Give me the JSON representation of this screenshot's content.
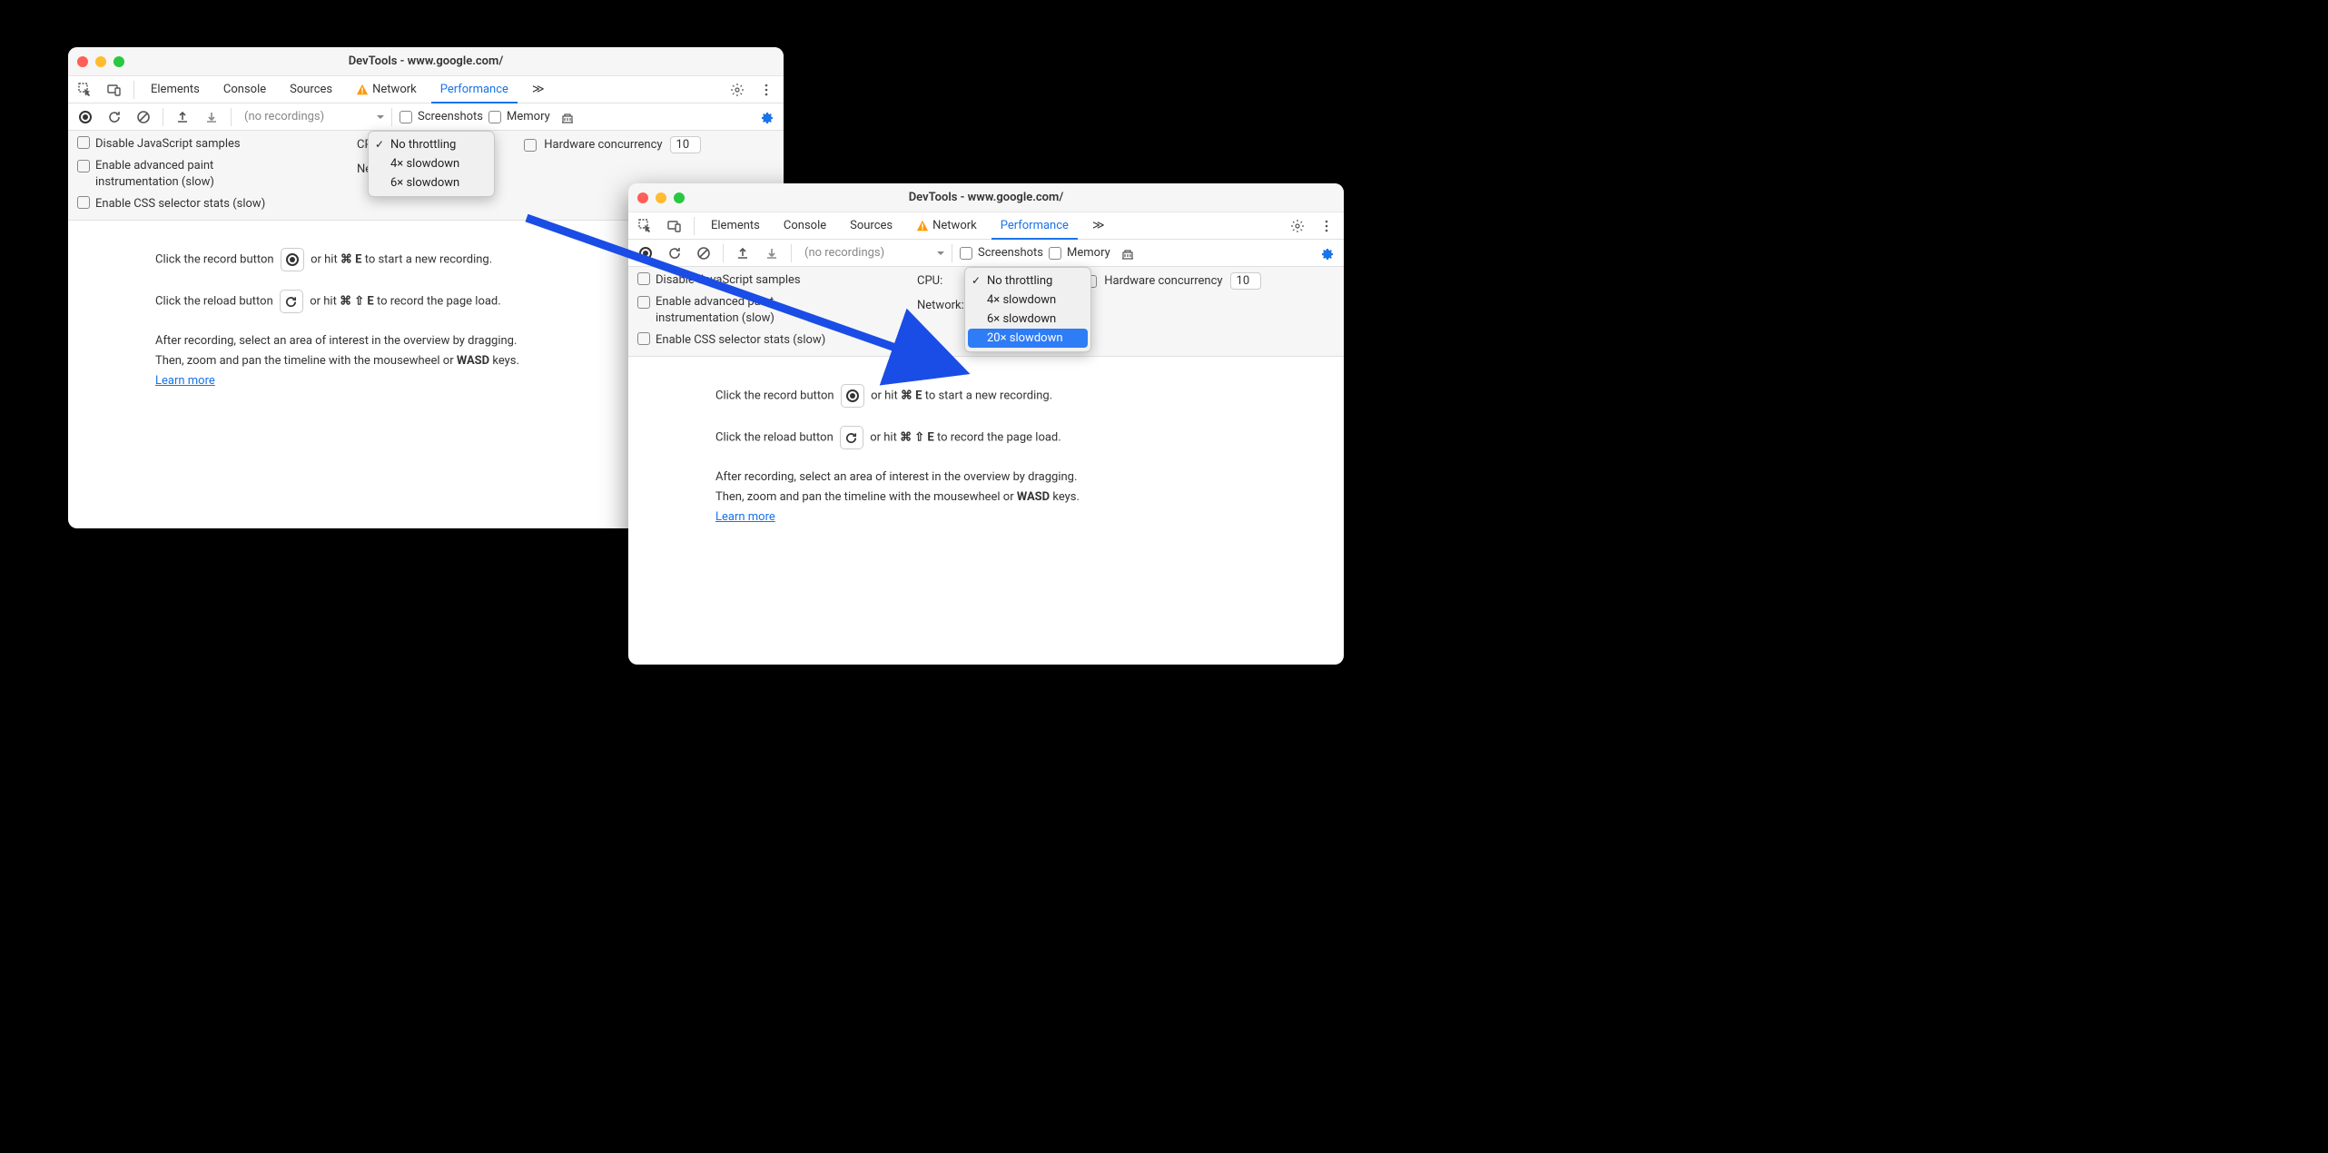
{
  "window1": {
    "title": "DevTools - www.google.com/",
    "tabs": {
      "elements": "Elements",
      "console": "Console",
      "sources": "Sources",
      "network": "Network",
      "performance": "Performance",
      "more": "≫"
    },
    "toolbar": {
      "no_recordings": "(no recordings)",
      "screenshots": "Screenshots",
      "memory": "Memory"
    },
    "settings": {
      "disable_js": "Disable JavaScript samples",
      "adv_paint_1": "Enable advanced paint",
      "adv_paint_2": "instrumentation (slow)",
      "css_stats": "Enable CSS selector stats (slow)",
      "cpu_label": "CPU:",
      "network_label": "Network:",
      "hw_conc": "Hardware concurrency",
      "hw_value": "10"
    },
    "dropdown": {
      "items": [
        "No throttling",
        "4× slowdown",
        "6× slowdown"
      ],
      "checked": 0
    },
    "content": {
      "l1a": "Click the record button ",
      "l1b": " or hit ",
      "l1key": "⌘ E",
      "l1c": " to start a new recording.",
      "l2a": "Click the reload button ",
      "l2b": " or hit ",
      "l2key": "⌘ ⇧ E",
      "l2c": " to record the page load.",
      "l3": "After recording, select an area of interest in the overview by dragging.",
      "l4a": "Then, zoom and pan the timeline with the mousewheel or ",
      "l4b": "WASD",
      "l4c": " keys.",
      "learn": "Learn more"
    }
  },
  "window2": {
    "title": "DevTools - www.google.com/",
    "tabs": {
      "elements": "Elements",
      "console": "Console",
      "sources": "Sources",
      "network": "Network",
      "performance": "Performance",
      "more": "≫"
    },
    "toolbar": {
      "no_recordings": "(no recordings)",
      "screenshots": "Screenshots",
      "memory": "Memory"
    },
    "settings": {
      "disable_js": "Disable JavaScript samples",
      "adv_paint_1": "Enable advanced paint",
      "adv_paint_2": "instrumentation (slow)",
      "css_stats": "Enable CSS selector stats (slow)",
      "cpu_label": "CPU:",
      "network_label": "Network:",
      "hw_conc": "Hardware concurrency",
      "hw_value": "10"
    },
    "dropdown": {
      "items": [
        "No throttling",
        "4× slowdown",
        "6× slowdown",
        "20× slowdown"
      ],
      "checked": 0,
      "selected": 3
    },
    "content": {
      "l1a": "Click the record button ",
      "l1b": " or hit ",
      "l1key": "⌘ E",
      "l1c": " to start a new recording.",
      "l2a": "Click the reload button ",
      "l2b": " or hit ",
      "l2key": "⌘ ⇧ E",
      "l2c": " to record the page load.",
      "l3": "After recording, select an area of interest in the overview by dragging.",
      "l4a": "Then, zoom and pan the timeline with the mousewheel or ",
      "l4b": "WASD",
      "l4c": " keys.",
      "learn": "Learn more"
    }
  }
}
